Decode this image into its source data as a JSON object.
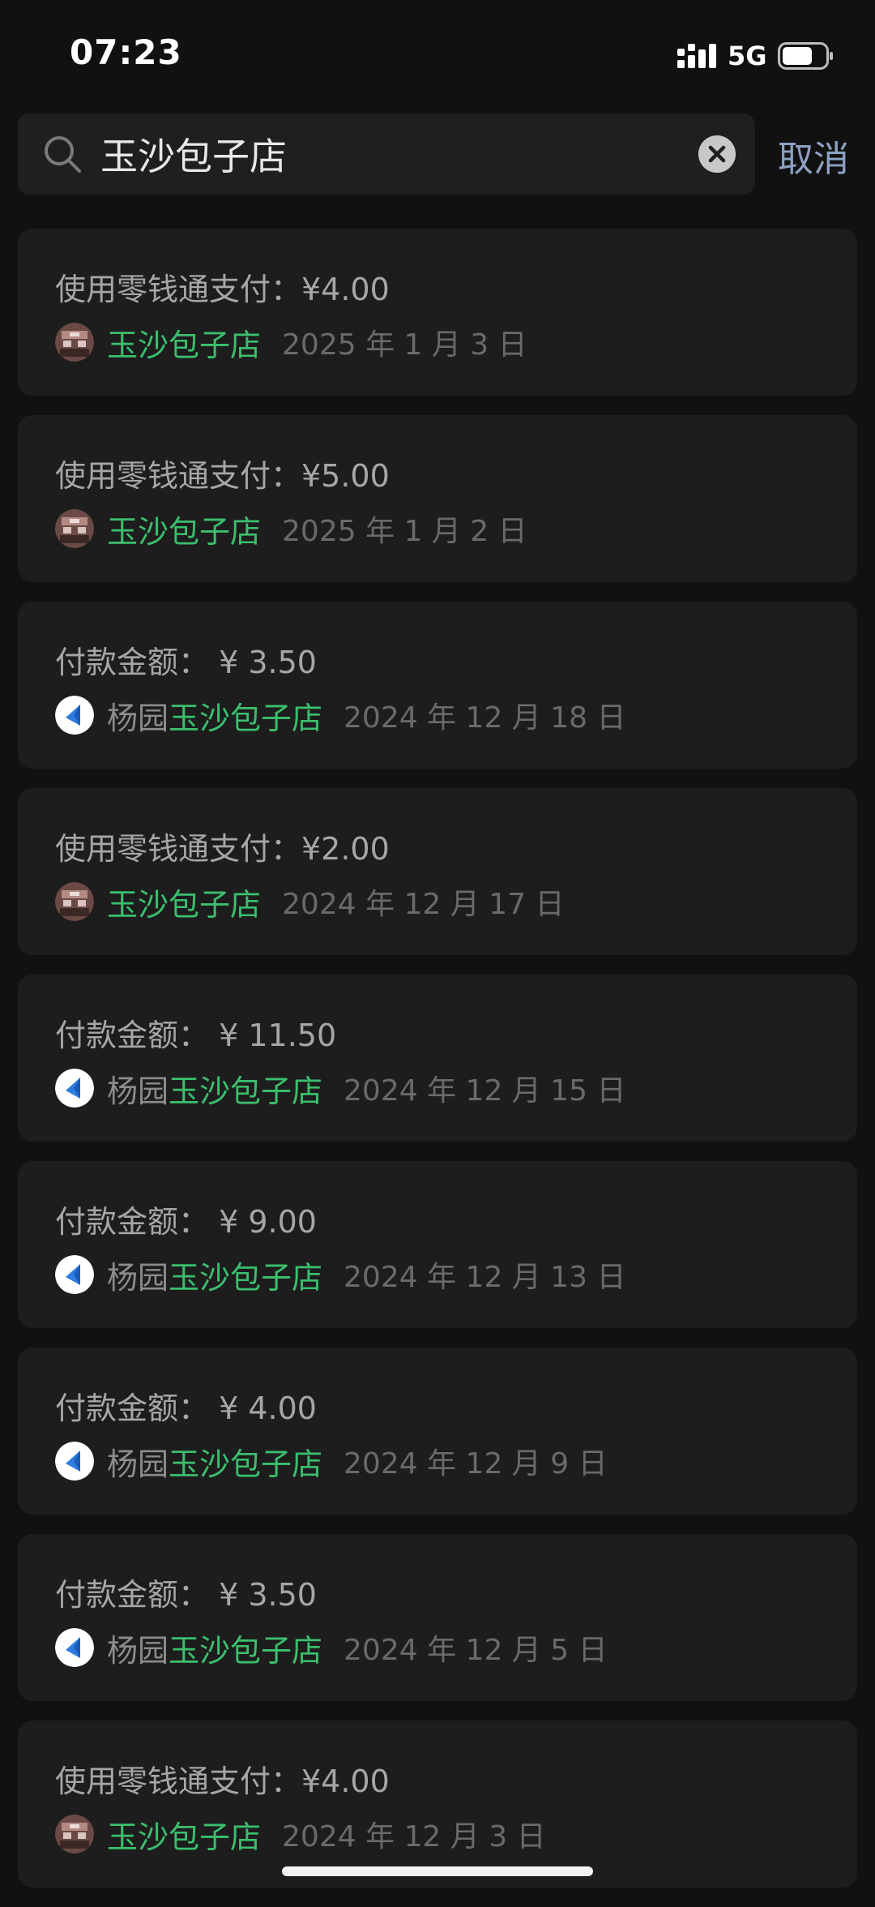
{
  "status_bar": {
    "time": "07:23",
    "network": "5G"
  },
  "search": {
    "query": "玉沙包子店",
    "placeholder": "",
    "cancel_label": "取消"
  },
  "icons": {
    "search": "search-icon",
    "clear": "clear-icon",
    "signal": "signal-icon",
    "battery": "battery-icon",
    "shop_avatar": "shop-photo-avatar",
    "pay_app_avatar": "blue-logo-avatar"
  },
  "colors": {
    "background": "#111111",
    "card": "#1d1d1d",
    "merchant_green": "#3bbf6d",
    "cancel_blue": "#8da1c2"
  },
  "records": [
    {
      "amount": "使用零钱通支付：¥4.00",
      "avatar": "shop",
      "prefix": "",
      "merchant": "玉沙包子店",
      "date": "2025 年 1 月 3 日"
    },
    {
      "amount": "使用零钱通支付：¥5.00",
      "avatar": "shop",
      "prefix": "",
      "merchant": "玉沙包子店",
      "date": "2025 年 1 月 2 日"
    },
    {
      "amount": "付款金额： ¥ 3.50",
      "avatar": "app",
      "prefix": "杨园",
      "merchant": "玉沙包子店",
      "date": "2024 年 12 月 18 日"
    },
    {
      "amount": "使用零钱通支付：¥2.00",
      "avatar": "shop",
      "prefix": "",
      "merchant": "玉沙包子店",
      "date": "2024 年 12 月 17 日"
    },
    {
      "amount": "付款金额： ¥ 11.50",
      "avatar": "app",
      "prefix": "杨园",
      "merchant": "玉沙包子店",
      "date": "2024 年 12 月 15 日"
    },
    {
      "amount": "付款金额： ¥ 9.00",
      "avatar": "app",
      "prefix": "杨园",
      "merchant": "玉沙包子店",
      "date": "2024 年 12 月 13 日"
    },
    {
      "amount": "付款金额： ¥ 4.00",
      "avatar": "app",
      "prefix": "杨园",
      "merchant": "玉沙包子店",
      "date": "2024 年 12 月 9 日"
    },
    {
      "amount": "付款金额： ¥ 3.50",
      "avatar": "app",
      "prefix": "杨园",
      "merchant": "玉沙包子店",
      "date": "2024 年 12 月 5 日"
    },
    {
      "amount": "使用零钱通支付：¥4.00",
      "avatar": "shop",
      "prefix": "",
      "merchant": "玉沙包子店",
      "date": "2024 年 12 月 3 日"
    }
  ]
}
